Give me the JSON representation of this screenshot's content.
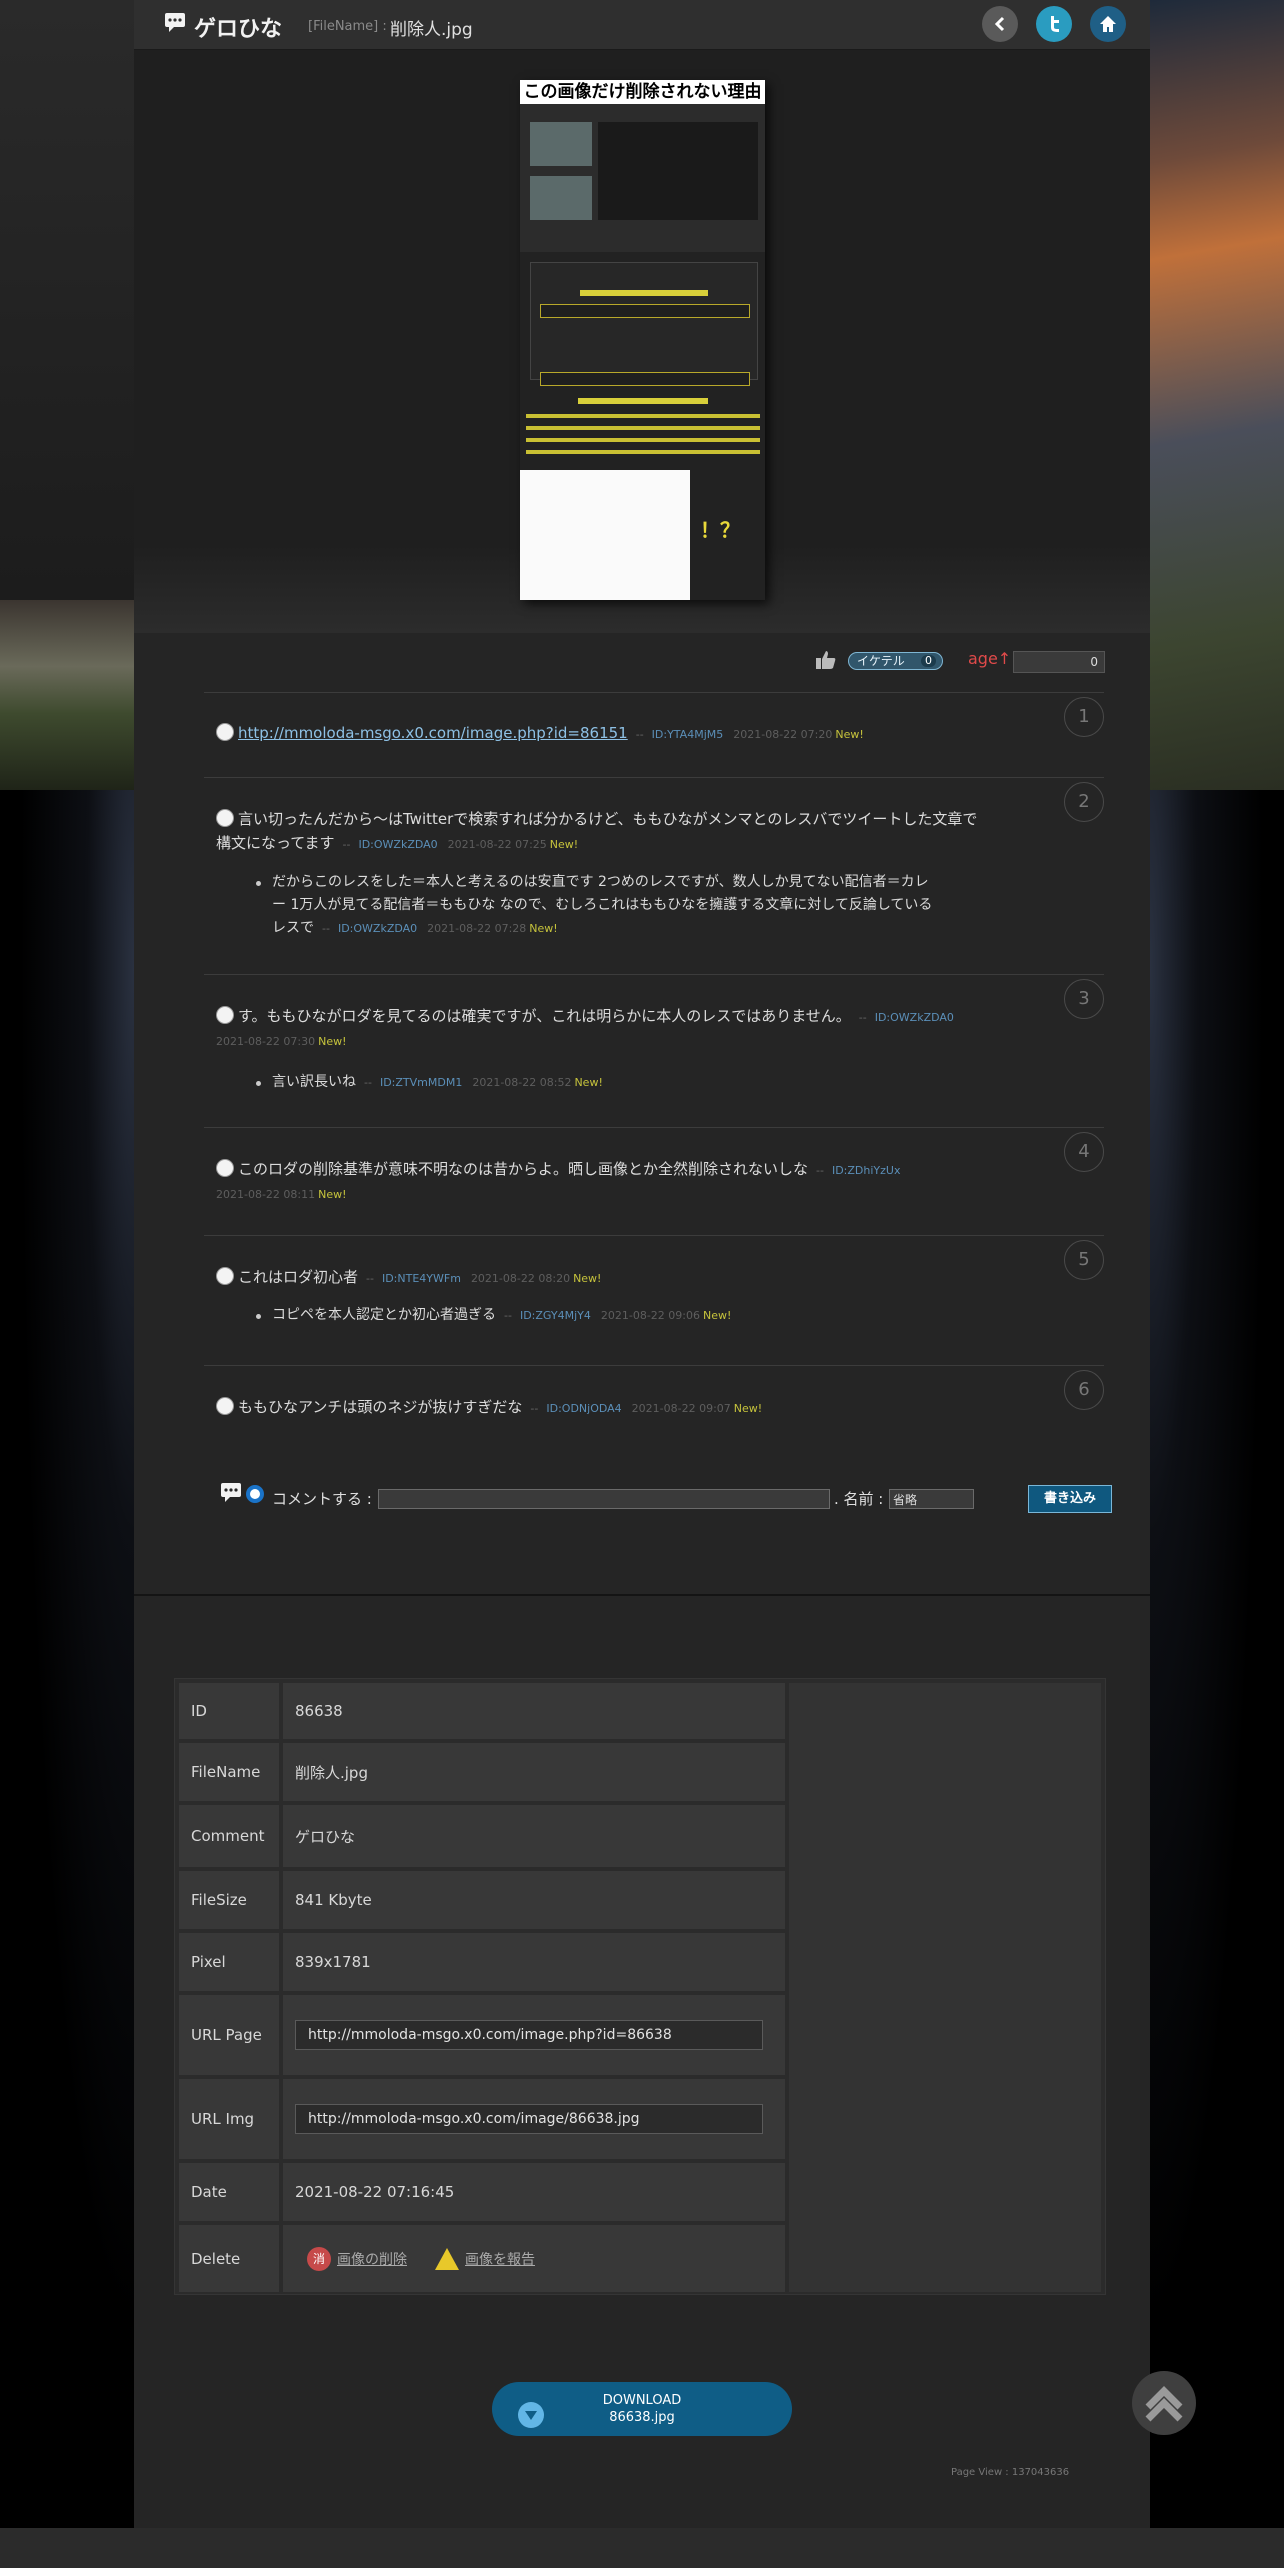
{
  "header": {
    "site_title": "ゲロひな",
    "filename_label": "[FileName] :",
    "filename_value": "削除人.jpg"
  },
  "preview": {
    "title": "この画像だけ削除されない理由",
    "ending_text": "！？"
  },
  "votes": {
    "iketel_label": "イケテル",
    "iketel_count": "0",
    "age_label": "age↑",
    "age_count": "0"
  },
  "comments": [
    {
      "num": "1",
      "link": "http://mmoloda-msgo.x0.com/image.php?id=86151",
      "id": "ID:YTA4MjM5",
      "date": "2021-08-22 07:20",
      "new": "New!",
      "replies": []
    },
    {
      "num": "2",
      "text_line1": "言い切ったんだから～はTwitterで検索すれば分かるけど、ももひながメンマとのレスバでツイートした文章で",
      "text_line2": "構文になってます",
      "id": "ID:OWZkZDA0",
      "date": "2021-08-22 07:25",
      "new": "New!",
      "replies": [
        {
          "line1": "だからこのレスをした＝本人と考えるのは安直です 2つめのレスですが、数人しか見てない配信者＝カレ",
          "line2": "ー 1万人が見てる配信者＝ももひな なので、むしろこれはももひなを擁護する文章に対して反論している",
          "line3": "レスで",
          "id": "ID:OWZkZDA0",
          "date": "2021-08-22 07:28",
          "new": "New!"
        }
      ]
    },
    {
      "num": "3",
      "text_line1": "す。ももひながロダを見てるのは確実ですが、これは明らかに本人のレスではありません。",
      "id": "ID:OWZkZDA0",
      "date": "2021-08-22 07:30",
      "new": "New!",
      "replies": [
        {
          "line1": "言い訳長いね",
          "id": "ID:ZTVmMDM1",
          "date": "2021-08-22 08:52",
          "new": "New!"
        }
      ]
    },
    {
      "num": "4",
      "text_line1": "このロダの削除基準が意味不明なのは昔からよ。晒し画像とか全然削除されないしな",
      "id": "ID:ZDhiYzUx",
      "date": "2021-08-22 08:11",
      "new": "New!",
      "replies": []
    },
    {
      "num": "5",
      "text_line1": "これはロダ初心者",
      "id": "ID:NTE4YWFm",
      "date": "2021-08-22 08:20",
      "new": "New!",
      "replies": [
        {
          "line1": "コピペを本人認定とか初心者過ぎる",
          "id": "ID:ZGY4MjY4",
          "date": "2021-08-22 09:06",
          "new": "New!"
        }
      ]
    },
    {
      "num": "6",
      "text_line1": "ももひなアンチは頭のネジが抜けすぎだな",
      "id": "ID:ODNjODA4",
      "date": "2021-08-22 09:07",
      "new": "New!",
      "replies": []
    }
  ],
  "separator": "--",
  "comment_form": {
    "comment_label": "コメントする :",
    "name_label": ". 名前 :",
    "name_value": "省略",
    "submit_label": "書き込み"
  },
  "info": {
    "rows": [
      {
        "key": "ID",
        "value": "86638"
      },
      {
        "key": "FileName",
        "value": "削除人.jpg"
      },
      {
        "key": "Comment",
        "value": "ゲロひな"
      },
      {
        "key": "FileSize",
        "value": "841 Kbyte"
      },
      {
        "key": "Pixel",
        "value": "839x1781"
      },
      {
        "key": "URL Page",
        "value": "http://mmoloda-msgo.x0.com/image.php?id=86638"
      },
      {
        "key": "URL Img",
        "value": "http://mmoloda-msgo.x0.com/image/86638.jpg"
      },
      {
        "key": "Date",
        "value": "2021-08-22 07:16:45"
      },
      {
        "key": "Delete",
        "delete_icon_text": "消",
        "delete_label": "画像の削除",
        "report_label": "画像を報告"
      }
    ]
  },
  "download": {
    "label": "DOWNLOAD",
    "filename": "86638.jpg"
  },
  "page_view": "Page View : 137043636",
  "colors": {
    "accent_blue": "#0f5d86",
    "id_blue": "#5b8fb8",
    "new_yellow": "#c6c33c",
    "age_red": "#e04a4a"
  }
}
